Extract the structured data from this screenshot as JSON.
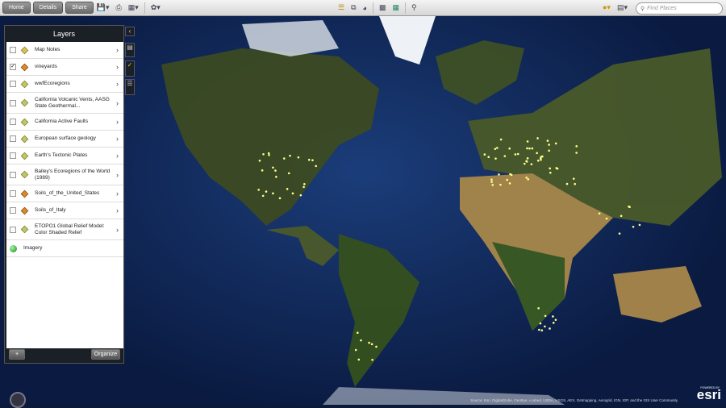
{
  "toolbar": {
    "home": "Home",
    "details": "Details",
    "share": "Share",
    "search_placeholder": "Find Places"
  },
  "layers": {
    "title": "Layers",
    "items": [
      {
        "label": "Map Notes",
        "checked": false
      },
      {
        "label": "vineyards",
        "checked": true
      },
      {
        "label": "wwfEcoregions",
        "checked": false
      },
      {
        "label": "California Volcanic Vents, AASG State Geothermal...",
        "checked": false
      },
      {
        "label": "California Active Faults",
        "checked": false
      },
      {
        "label": "European surface geology",
        "checked": false
      },
      {
        "label": "Earth's Tectonic Plates",
        "checked": false
      },
      {
        "label": "Bailey's Ecoregions of the World (1989)",
        "checked": false
      },
      {
        "label": "Soils_of_the_United_States",
        "checked": false
      },
      {
        "label": "Soils_of_Italy",
        "checked": false
      },
      {
        "label": "ETOPO1 Global Relief Model: Color Shaded Relief",
        "checked": false
      }
    ],
    "basemap": "Imagery",
    "add": "+",
    "organize": "Organize"
  },
  "map": {
    "attribution": "Source: Esri, DigitalGlobe, GeoEye, i-cubed, USDA, USGS, AEX, Getmapping, Aerogrid, IGN, IGP, and the GIS User Community",
    "logo_small": "POWERED BY",
    "logo": "esri"
  }
}
